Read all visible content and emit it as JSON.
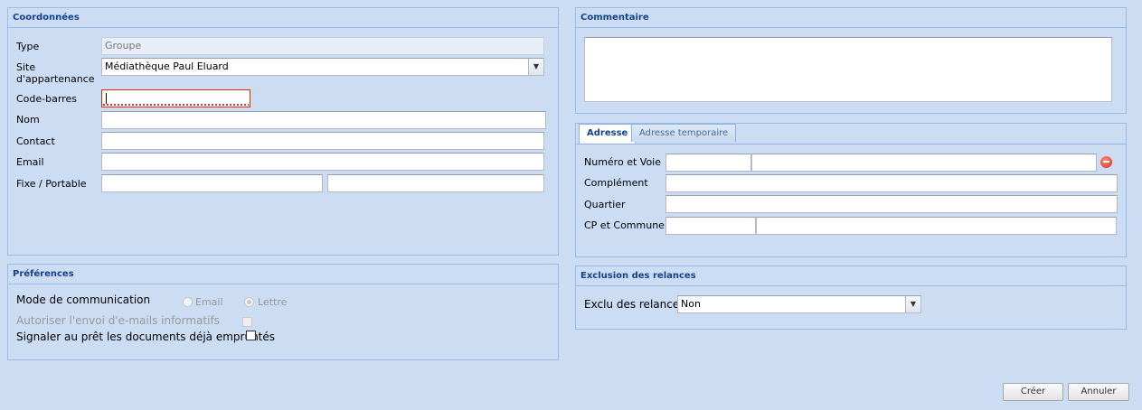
{
  "coordonnees": {
    "title": "Coordonnées",
    "type_label": "Type",
    "type_value": "Groupe",
    "site_label_1": "Site",
    "site_label_2": "d'appartenance",
    "site_value": "Médiathèque Paul Eluard",
    "codebarres_label": "Code-barres",
    "codebarres_value": "",
    "nom_label": "Nom",
    "nom_value": "",
    "contact_label": "Contact",
    "contact_value": "",
    "email_label": "Email",
    "email_value": "",
    "fixe_label": "Fixe / Portable",
    "fixe_value": "",
    "portable_value": ""
  },
  "commentaire": {
    "title": "Commentaire",
    "value": ""
  },
  "adresse": {
    "tabs": [
      "Adresse",
      "Adresse temporaire"
    ],
    "active_tab": "Adresse",
    "numero_label": "Numéro et Voie",
    "complement_label": "Complément",
    "quartier_label": "Quartier",
    "cp_label": "CP et Commune",
    "remove_icon": "remove-icon"
  },
  "preferences": {
    "title": "Préférences",
    "mode_label": "Mode de communication",
    "mode_options": [
      "Email",
      "Lettre"
    ],
    "mode_selected": "Lettre",
    "autoriser_label": "Autoriser l'envoi d'e-mails informatifs",
    "signaler_label": "Signaler au prêt les documents déjà empruntés"
  },
  "exclusion": {
    "title": "Exclusion des relances",
    "label": "Exclu des relances",
    "value": "Non"
  },
  "actions": {
    "creer_label": "Créer",
    "annuler_label": "Annuler"
  },
  "colors": {
    "background": "#cbdcf3",
    "header_text": "#15428b",
    "border": "#99bbe8",
    "invalid": "#cc3300"
  }
}
